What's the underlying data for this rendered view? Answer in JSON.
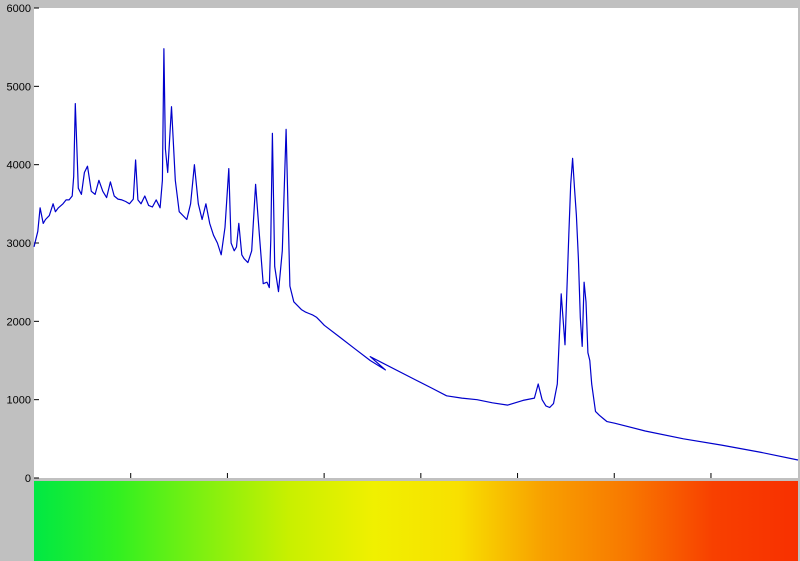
{
  "chart_data": {
    "type": "line",
    "title": "",
    "xlabel": "",
    "ylabel": "",
    "ylim": [
      0,
      6000
    ],
    "y_ticks": [
      "0",
      "1000",
      "2000",
      "3000",
      "4000",
      "5000",
      "6000"
    ],
    "y_tick_values": [
      0,
      1000,
      2000,
      3000,
      4000,
      5000,
      6000
    ],
    "x_tick_count": 7,
    "grid": false,
    "legend": "none",
    "background_color": "#ffffff",
    "frame_color": "#c0c0c0",
    "series": [
      {
        "color": "#0000cc",
        "x": [
          0,
          0.005,
          0.008,
          0.012,
          0.015,
          0.02,
          0.025,
          0.028,
          0.032,
          0.038,
          0.042,
          0.046,
          0.05,
          0.052,
          0.054,
          0.058,
          0.062,
          0.066,
          0.07,
          0.075,
          0.08,
          0.085,
          0.09,
          0.095,
          0.1,
          0.105,
          0.11,
          0.115,
          0.12,
          0.125,
          0.13,
          0.133,
          0.136,
          0.14,
          0.145,
          0.15,
          0.155,
          0.16,
          0.165,
          0.168,
          0.17,
          0.172,
          0.175,
          0.18,
          0.185,
          0.19,
          0.2,
          0.205,
          0.21,
          0.215,
          0.22,
          0.225,
          0.23,
          0.235,
          0.24,
          0.245,
          0.25,
          0.255,
          0.258,
          0.262,
          0.265,
          0.268,
          0.272,
          0.275,
          0.28,
          0.285,
          0.29,
          0.295,
          0.3,
          0.305,
          0.308,
          0.31,
          0.312,
          0.315,
          0.32,
          0.325,
          0.33,
          0.335,
          0.34,
          0.345,
          0.35,
          0.355,
          0.36,
          0.365,
          0.37,
          0.375,
          0.38,
          0.4,
          0.42,
          0.44,
          0.46,
          0.44,
          0.5,
          0.52,
          0.54,
          0.56,
          0.58,
          0.6,
          0.62,
          0.64,
          0.655,
          0.66,
          0.665,
          0.67,
          0.675,
          0.68,
          0.685,
          0.69,
          0.695,
          0.7,
          0.7025,
          0.705,
          0.7075,
          0.71,
          0.7125,
          0.715,
          0.7175,
          0.72,
          0.7225,
          0.725,
          0.7275,
          0.73,
          0.735,
          0.74,
          0.745,
          0.75,
          0.76,
          0.8,
          0.85,
          0.9,
          0.95,
          1.0
        ],
        "y": [
          2950,
          3150,
          3450,
          3250,
          3300,
          3350,
          3500,
          3400,
          3450,
          3500,
          3550,
          3550,
          3600,
          3850,
          4780,
          3700,
          3620,
          3900,
          3980,
          3660,
          3620,
          3800,
          3660,
          3580,
          3780,
          3600,
          3560,
          3550,
          3530,
          3500,
          3560,
          4060,
          3550,
          3500,
          3600,
          3480,
          3460,
          3550,
          3450,
          3800,
          5480,
          4200,
          3900,
          4740,
          3800,
          3400,
          3300,
          3500,
          4000,
          3500,
          3300,
          3500,
          3250,
          3100,
          3000,
          2850,
          3200,
          3950,
          3000,
          2900,
          2950,
          3250,
          2850,
          2800,
          2750,
          2900,
          3750,
          3100,
          2480,
          2500,
          2430,
          3050,
          4400,
          2700,
          2380,
          2900,
          4450,
          2450,
          2250,
          2200,
          2150,
          2120,
          2100,
          2080,
          2050,
          2000,
          1950,
          1800,
          1650,
          1500,
          1380,
          1550,
          1250,
          1150,
          1050,
          1020,
          1000,
          960,
          930,
          990,
          1020,
          1200,
          1000,
          920,
          900,
          950,
          1200,
          2350,
          1700,
          3100,
          3750,
          4080,
          3700,
          3350,
          2800,
          2050,
          1680,
          2500,
          2250,
          1600,
          1500,
          1200,
          850,
          800,
          760,
          720,
          700,
          600,
          500,
          420,
          330,
          230
        ]
      }
    ]
  },
  "color_bar": {
    "stops": [
      "#00e844",
      "#33f020",
      "#80f010",
      "#c8f000",
      "#f0f000",
      "#f8e000",
      "#f8a000",
      "#f87800",
      "#f84000",
      "#f83000"
    ]
  }
}
